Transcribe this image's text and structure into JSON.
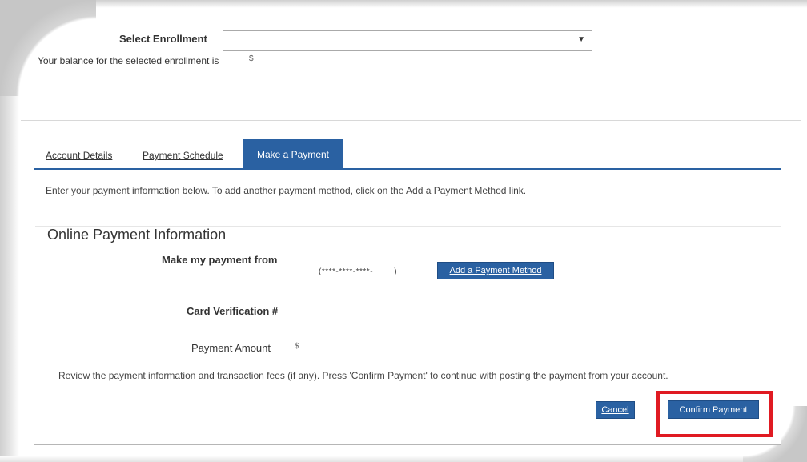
{
  "enrollment": {
    "label": "Select Enrollment",
    "selected_value": "",
    "balance_text": "Your balance for the selected enrollment is",
    "balance_amount": "$"
  },
  "tabs": [
    {
      "label": "Account Details",
      "active": false
    },
    {
      "label": "Payment Schedule",
      "active": false
    },
    {
      "label": "Make a Payment",
      "active": true
    }
  ],
  "payment": {
    "intro": "Enter your payment information below. To add another payment method, click on the Add a Payment Method link.",
    "section_title": "Online Payment Information",
    "pay_from_label": "Make my payment from",
    "card_mask": "(****-****-****-        )",
    "add_method_label": "Add a Payment Method",
    "cvv_label": "Card Verification #",
    "amount_label": "Payment Amount",
    "amount_value": "$",
    "review_text": "Review the payment information and transaction fees (if any). Press 'Confirm Payment' to continue with posting the payment from your account.",
    "cancel_label": "Cancel",
    "confirm_label": "Confirm Payment"
  },
  "colors": {
    "accent": "#2a61a2",
    "highlight": "#e01a22"
  }
}
